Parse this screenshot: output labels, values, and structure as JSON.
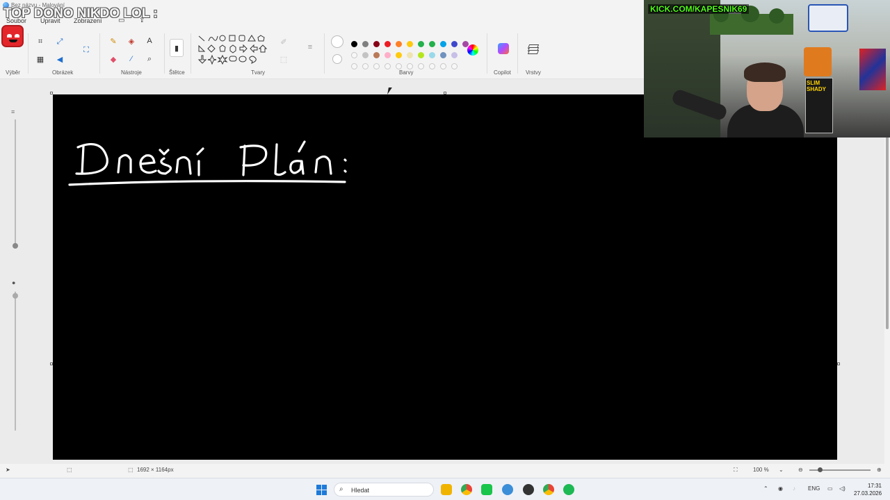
{
  "window": {
    "title": "Bez názvu - Malování"
  },
  "overlay": {
    "text": "TOP DONO NIKDO LOL :"
  },
  "menu": {
    "items": [
      "Soubor",
      "Upravit",
      "Zobrazení"
    ]
  },
  "ribbon": {
    "groups": [
      "Výběr",
      "Obrázek",
      "Nástroje",
      "Štětce",
      "Tvary",
      "Barvy",
      "Copilot",
      "Vrstvy"
    ]
  },
  "palette": {
    "row1": [
      "#000000",
      "#7f7f7f",
      "#880015",
      "#ed1c24",
      "#ff7f27",
      "#ffc90e",
      "#22b14c",
      "#22b14c",
      "#00a2e8",
      "#3f48cc",
      "#a349a4"
    ],
    "row2": [
      "empty",
      "#c3c3c3",
      "#b97a57",
      "#ffaec9",
      "#ffc90e",
      "#efe4b0",
      "#b5e61d",
      "#99d9ea",
      "#7092be",
      "#c8bfe7"
    ],
    "row3": [
      "empty",
      "empty",
      "empty",
      "empty",
      "empty",
      "empty",
      "empty",
      "empty",
      "empty",
      "empty"
    ]
  },
  "canvas": {
    "handwriting": "Dnešní Plán:",
    "background": "#000000",
    "ink": "#ffffff"
  },
  "webcam": {
    "banner": "KICK.COM/KAPESNIK69",
    "poster_label": "SLIM SHADY"
  },
  "status": {
    "dimensions": "1692 × 1164px",
    "zoom": "100 %"
  },
  "taskbar": {
    "search_placeholder": "Hledat",
    "lang": "ENG",
    "time": "17:31",
    "date": "27.03.2026"
  }
}
